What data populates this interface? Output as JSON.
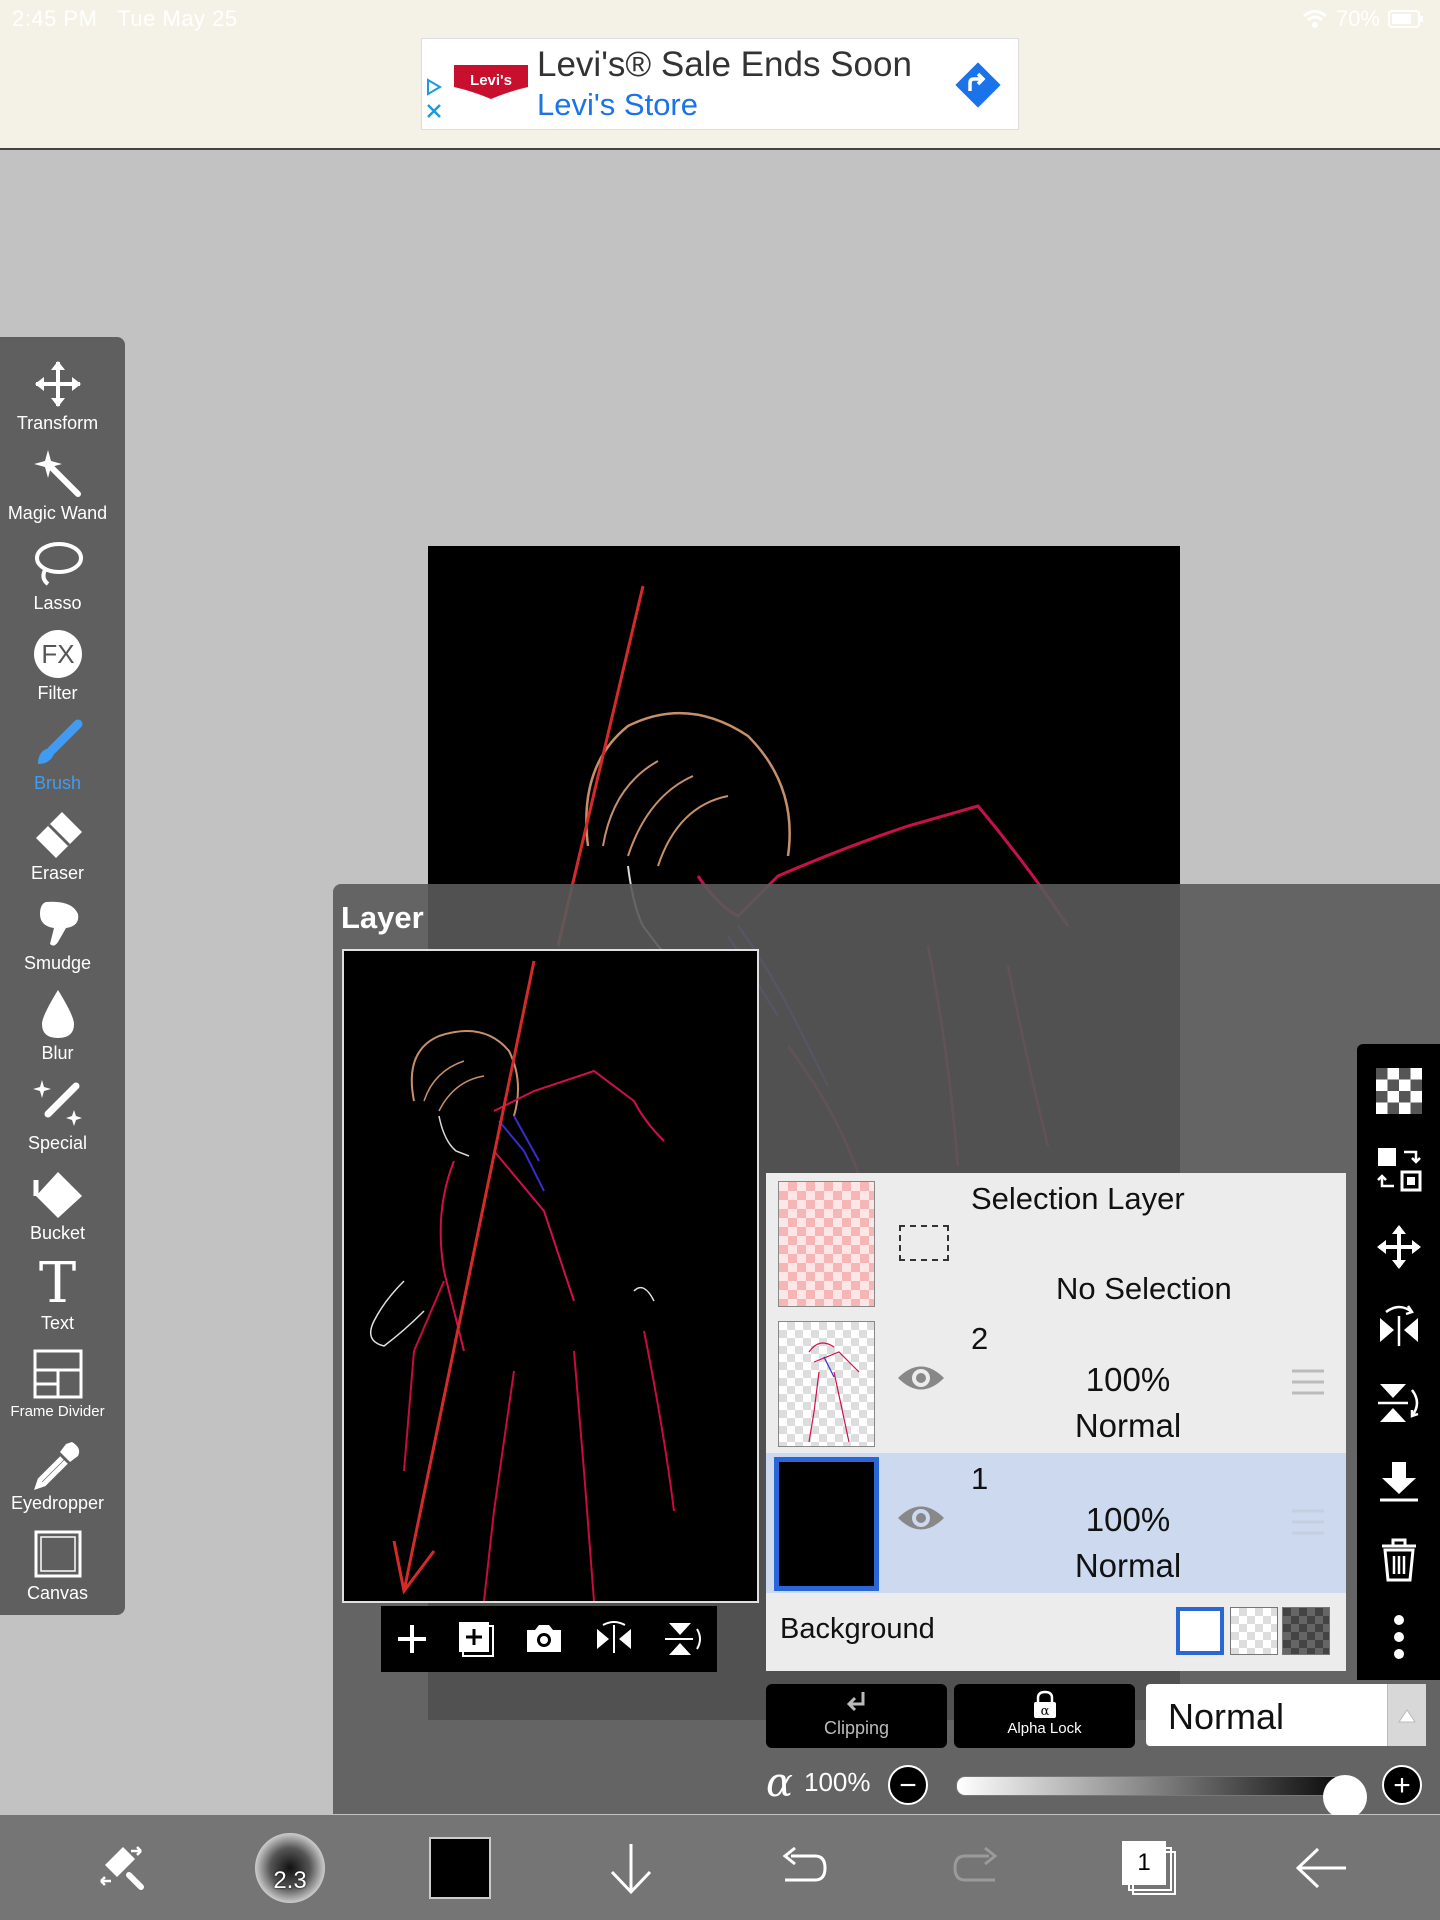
{
  "status": {
    "time": "2:45 PM",
    "date": "Tue May 25",
    "battery": "70%"
  },
  "ad": {
    "brand_logo": "Levi's",
    "title": "Levi's® Sale Ends Soon",
    "subtitle": "Levi's Store"
  },
  "toolbar": {
    "tools": [
      {
        "label": "Transform",
        "icon": "move-arrows-icon"
      },
      {
        "label": "Magic Wand",
        "icon": "magic-wand-icon"
      },
      {
        "label": "Lasso",
        "icon": "lasso-icon"
      },
      {
        "label": "Filter",
        "icon": "fx-icon",
        "icon_text": "FX"
      },
      {
        "label": "Brush",
        "icon": "brush-icon",
        "active": true
      },
      {
        "label": "Eraser",
        "icon": "eraser-icon"
      },
      {
        "label": "Smudge",
        "icon": "smudge-icon"
      },
      {
        "label": "Blur",
        "icon": "drop-icon"
      },
      {
        "label": "Special",
        "icon": "sparkle-brush-icon"
      },
      {
        "label": "Bucket",
        "icon": "bucket-icon"
      },
      {
        "label": "Text",
        "icon": "text-icon",
        "icon_text": "T"
      },
      {
        "label": "Frame Divider",
        "icon": "frame-divider-icon"
      },
      {
        "label": "Eyedropper",
        "icon": "eyedropper-icon"
      },
      {
        "label": "Canvas",
        "icon": "canvas-icon"
      }
    ]
  },
  "layer_panel": {
    "title": "Layer",
    "selection_layer": {
      "name": "Selection Layer",
      "status": "No Selection"
    },
    "layers": [
      {
        "name": "2",
        "opacity": "100%",
        "mode": "Normal",
        "selected": false
      },
      {
        "name": "1",
        "opacity": "100%",
        "mode": "Normal",
        "selected": true
      }
    ],
    "background_label": "Background",
    "clipping_label": "Clipping",
    "alpha_lock_label": "Alpha Lock",
    "blend_mode": "Normal",
    "alpha_symbol": "α",
    "opacity_value": "100%",
    "opacity_fraction": 1.0,
    "minus": "−",
    "plus": "+"
  },
  "bottom_bar": {
    "brush_size": "2.3",
    "layer_count": "1",
    "color": "#000000"
  },
  "colors": {
    "accent": "#3f9cf2",
    "selected_row": "#ccd9ee",
    "line_red": "#d42a2a"
  }
}
